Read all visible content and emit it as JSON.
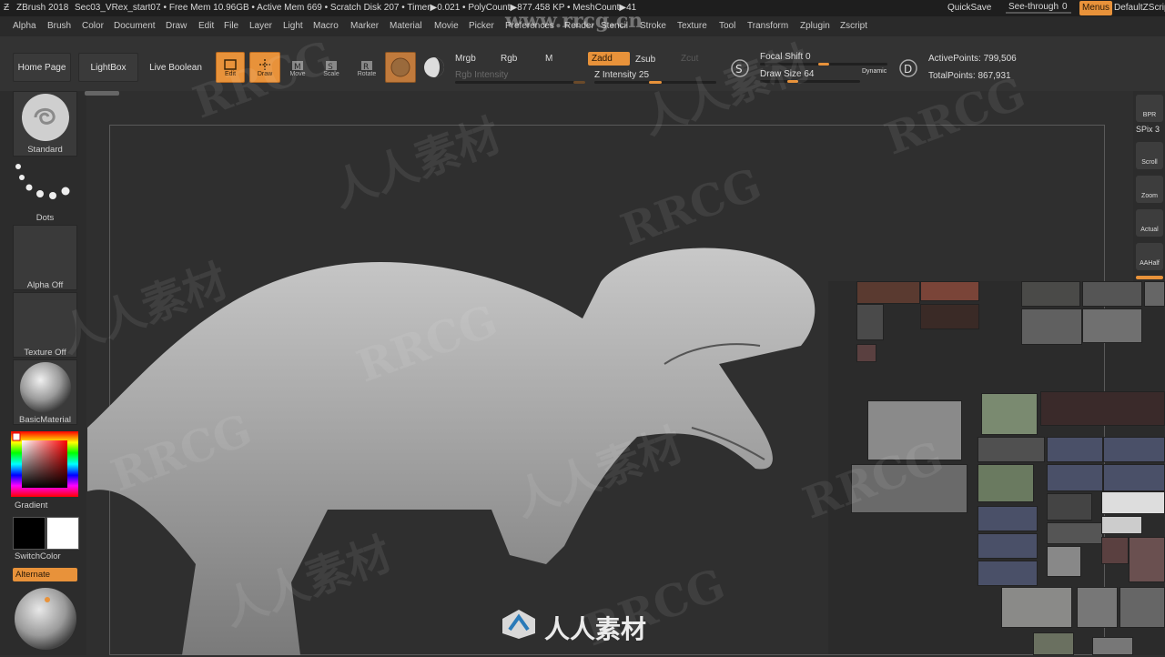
{
  "titlebar": {
    "app": "ZBrush 2018",
    "file": "Sec03_VRex_start07",
    "stats": ". • Free Mem 10.96GB • Active Mem 669 • Scratch Disk 207 • Timer▶0.021 • PolyCount▶877.458 KP • MeshCount▶41",
    "quicksave": "QuickSave",
    "seethrough": "See-through",
    "seethrough_value": "0",
    "seethrough_level": 0,
    "menus": "Menus",
    "default_script": "DefaultZScript"
  },
  "menubar": {
    "items": [
      "Alpha",
      "Brush",
      "Color",
      "Document",
      "Draw",
      "Edit",
      "File",
      "Layer",
      "Light",
      "Macro",
      "Marker",
      "Material",
      "Movie",
      "Picker",
      "Preferences",
      "Render",
      "Stencil",
      "Stroke",
      "Texture",
      "Tool",
      "Transform",
      "Zplugin",
      "Zscript"
    ]
  },
  "toolbar": {
    "home_page": "Home Page",
    "lightbox": "LightBox",
    "live_boolean": "Live Boolean",
    "edit": "Edit",
    "draw": "Draw",
    "move": "Move",
    "scale": "Scale",
    "rotate": "Rotate",
    "mrgb": "Mrgb",
    "rgb": "Rgb",
    "m": "M",
    "zadd": "Zadd",
    "zsub": "Zsub",
    "zcut": "Zcut",
    "rgb_intensity": "Rgb Intensity",
    "z_intensity_label": "Z Intensity",
    "z_intensity_value": "25",
    "focal_shift_label": "Focal Shift",
    "focal_shift_value": "0",
    "draw_size_label": "Draw Size",
    "draw_size_value": "64",
    "dynamic": "Dynamic",
    "active_points": "ActivePoints: 799,506",
    "total_points": "TotalPoints: 867,931"
  },
  "leftpanel": {
    "brush": "Standard",
    "stroke": "Dots",
    "alpha": "Alpha Off",
    "texture": "Texture Off",
    "material": "BasicMaterial",
    "gradient": "Gradient",
    "switchcolor": "SwitchColor",
    "alternate": "Alternate"
  },
  "rightpanel": {
    "bpr": "BPR",
    "spix_label": "SPix",
    "spix_value": "3",
    "scroll": "Scroll",
    "zoom": "Zoom",
    "actual": "Actual",
    "aahalf": "AAHalf"
  },
  "watermark": {
    "site": "www.rrcg.cn",
    "brand": "RRCG",
    "chinese": "人人素材"
  },
  "colors": {
    "accent": "#e8923a",
    "background": "#2f2f2f",
    "primary_color": "#000000",
    "secondary_color": "#ffffff"
  }
}
